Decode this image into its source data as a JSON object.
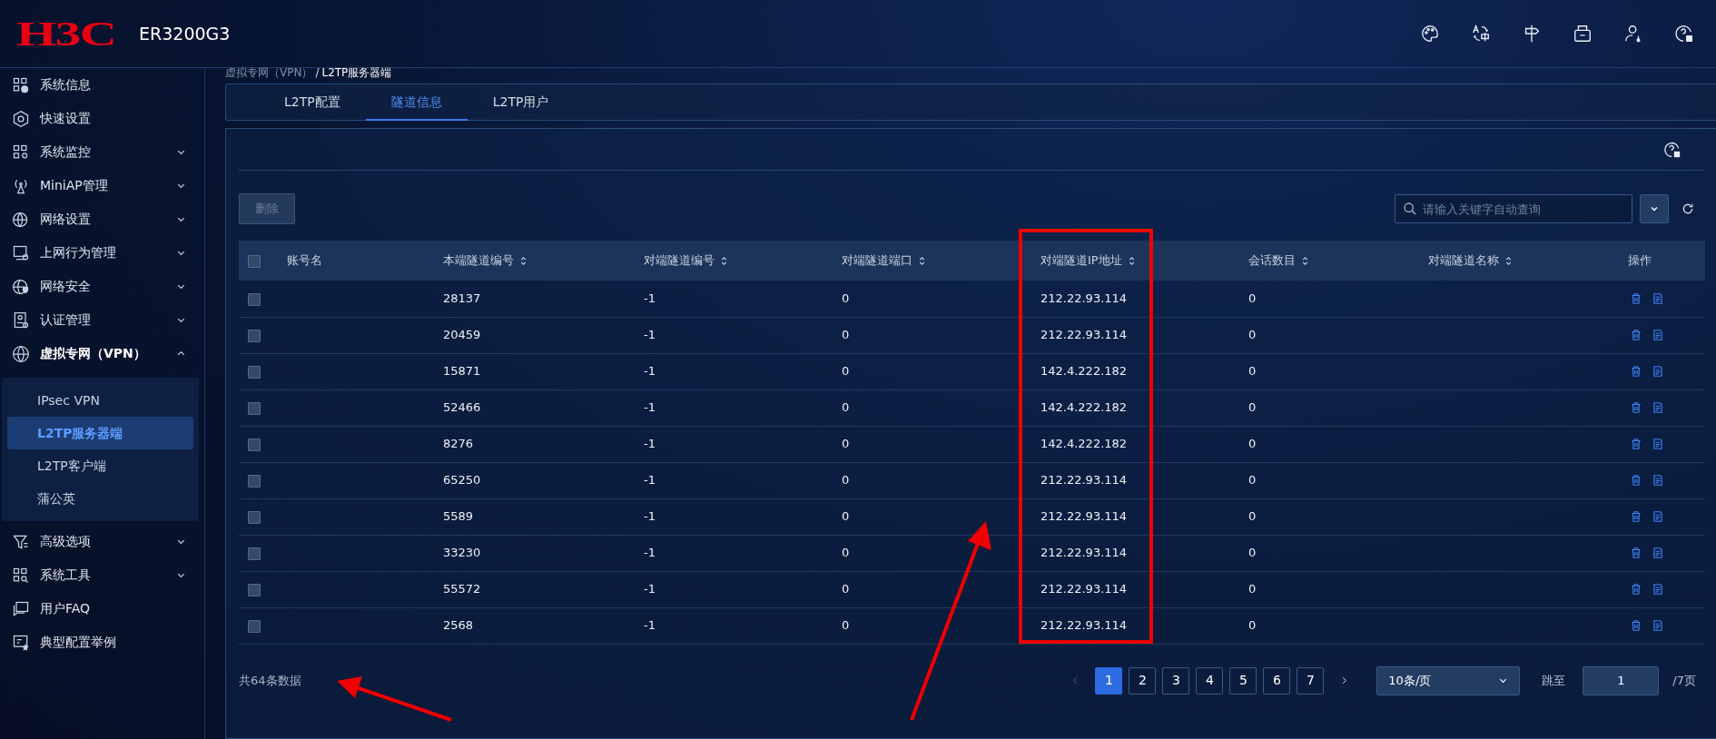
{
  "header": {
    "logo": "H3C",
    "model": "ER3200G3"
  },
  "sidebar": {
    "items": [
      {
        "label": "系统信息"
      },
      {
        "label": "快速设置"
      },
      {
        "label": "系统监控",
        "expanded": false
      },
      {
        "label": "MiniAP管理",
        "expanded": false
      },
      {
        "label": "网络设置",
        "expanded": false
      },
      {
        "label": "上网行为管理",
        "expanded": false
      },
      {
        "label": "网络安全",
        "expanded": false
      },
      {
        "label": "认证管理",
        "expanded": false
      },
      {
        "label": "虚拟专网（VPN）",
        "expanded": true,
        "children": [
          {
            "label": "IPsec VPN",
            "selected": false
          },
          {
            "label": "L2TP服务器端",
            "selected": true
          },
          {
            "label": "L2TP客户端",
            "selected": false
          },
          {
            "label": "蒲公英",
            "selected": false
          }
        ]
      },
      {
        "label": "高级选项",
        "expanded": false
      },
      {
        "label": "系统工具",
        "expanded": false
      },
      {
        "label": "用户FAQ"
      },
      {
        "label": "典型配置举例"
      }
    ]
  },
  "breadcrumb": [
    "虚拟专网（VPN）",
    "/",
    "L2TP服务器端"
  ],
  "tabs": [
    {
      "label": "L2TP配置",
      "selected": false
    },
    {
      "label": "隧道信息",
      "selected": true
    },
    {
      "label": "L2TP用户",
      "selected": false
    }
  ],
  "toolbar": {
    "delete_button": {
      "label": "删除",
      "disabled": true
    },
    "search": {
      "placeholder": "请输入关键字自动查询"
    }
  },
  "table": {
    "select_all_checked": false,
    "columns": [
      {
        "label": "账号名",
        "sortable": false
      },
      {
        "label": "本端隧道编号",
        "sortable": true
      },
      {
        "label": "对端隧道编号",
        "sortable": true
      },
      {
        "label": "对端隧道端口",
        "sortable": true
      },
      {
        "label": "对端隧道IP地址",
        "sortable": true
      },
      {
        "label": "会话数目",
        "sortable": true
      },
      {
        "label": "对端隧道名称",
        "sortable": true
      },
      {
        "label": "操作",
        "sortable": false
      }
    ],
    "rows": [
      {
        "checked": false,
        "cells": [
          "",
          "28137",
          "-1",
          "0",
          "212.22.93.114",
          "0",
          ""
        ]
      },
      {
        "checked": false,
        "cells": [
          "",
          "20459",
          "-1",
          "0",
          "212.22.93.114",
          "0",
          ""
        ]
      },
      {
        "checked": false,
        "cells": [
          "",
          "15871",
          "-1",
          "0",
          "142.4.222.182",
          "0",
          ""
        ]
      },
      {
        "checked": false,
        "cells": [
          "",
          "52466",
          "-1",
          "0",
          "142.4.222.182",
          "0",
          ""
        ]
      },
      {
        "checked": false,
        "cells": [
          "",
          "8276",
          "-1",
          "0",
          "142.4.222.182",
          "0",
          ""
        ]
      },
      {
        "checked": false,
        "cells": [
          "",
          "65250",
          "-1",
          "0",
          "212.22.93.114",
          "0",
          ""
        ]
      },
      {
        "checked": false,
        "cells": [
          "",
          "5589",
          "-1",
          "0",
          "212.22.93.114",
          "0",
          ""
        ]
      },
      {
        "checked": false,
        "cells": [
          "",
          "33230",
          "-1",
          "0",
          "212.22.93.114",
          "0",
          ""
        ]
      },
      {
        "checked": false,
        "cells": [
          "",
          "55572",
          "-1",
          "0",
          "212.22.93.114",
          "0",
          ""
        ]
      },
      {
        "checked": false,
        "cells": [
          "",
          "2568",
          "-1",
          "0",
          "212.22.93.114",
          "0",
          ""
        ]
      }
    ]
  },
  "pagination": {
    "total": "共64条数据",
    "prev_disabled": true,
    "pages": [
      {
        "label": "1",
        "selected": true
      },
      {
        "label": "2",
        "selected": false
      },
      {
        "label": "3",
        "selected": false
      },
      {
        "label": "4",
        "selected": false
      },
      {
        "label": "5",
        "selected": false
      },
      {
        "label": "6",
        "selected": false
      },
      {
        "label": "7",
        "selected": false
      }
    ],
    "page_size": "10条/页",
    "jump_label": "跳至",
    "jump_value": "1",
    "page_count": "/7页"
  }
}
